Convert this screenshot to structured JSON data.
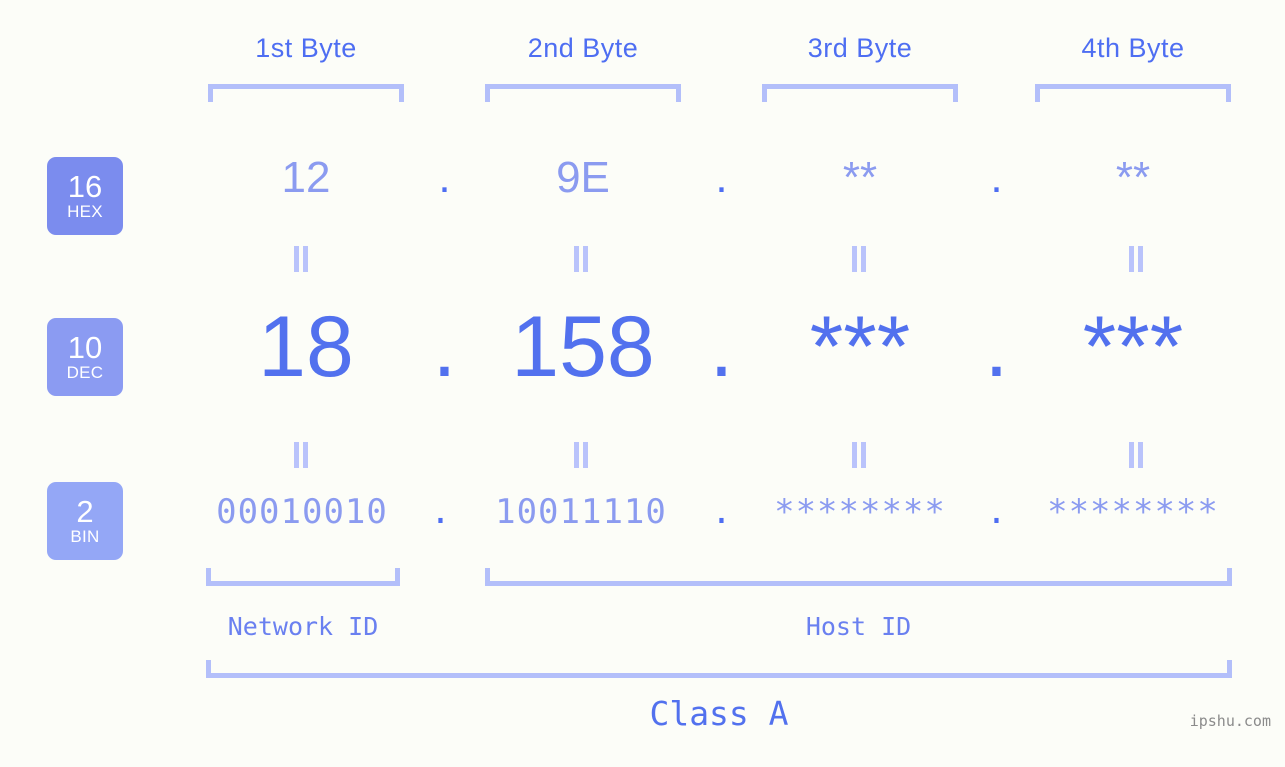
{
  "background_color": "#fcfdf8",
  "accent_color": "#5271ee",
  "accent_light_color": "#8b9bf0",
  "bracket_color": "#b3bffa",
  "byte_headers": [
    {
      "label": "1st Byte"
    },
    {
      "label": "2nd Byte"
    },
    {
      "label": "3rd Byte"
    },
    {
      "label": "4th Byte"
    }
  ],
  "bases": [
    {
      "number": "16",
      "name": "HEX",
      "color": "#7b8cee"
    },
    {
      "number": "10",
      "name": "DEC",
      "color": "#8b9bf2"
    },
    {
      "number": "2",
      "name": "BIN",
      "color": "#94a7f6"
    }
  ],
  "rows": {
    "hex": {
      "base_number": "16",
      "base_name": "HEX",
      "values": [
        "12",
        "9E",
        "**",
        "**"
      ],
      "separator": "."
    },
    "dec": {
      "base_number": "10",
      "base_name": "DEC",
      "values": [
        "18",
        "158",
        "***",
        "***"
      ],
      "separator": "."
    },
    "bin": {
      "base_number": "2",
      "base_name": "BIN",
      "values": [
        "00010010",
        "10011110",
        "********",
        "********"
      ],
      "separator": "."
    }
  },
  "equals_symbol": "=",
  "sections": {
    "network_id": "Network ID",
    "host_id": "Host ID",
    "class": "Class A"
  },
  "watermark": "ipshu.com"
}
